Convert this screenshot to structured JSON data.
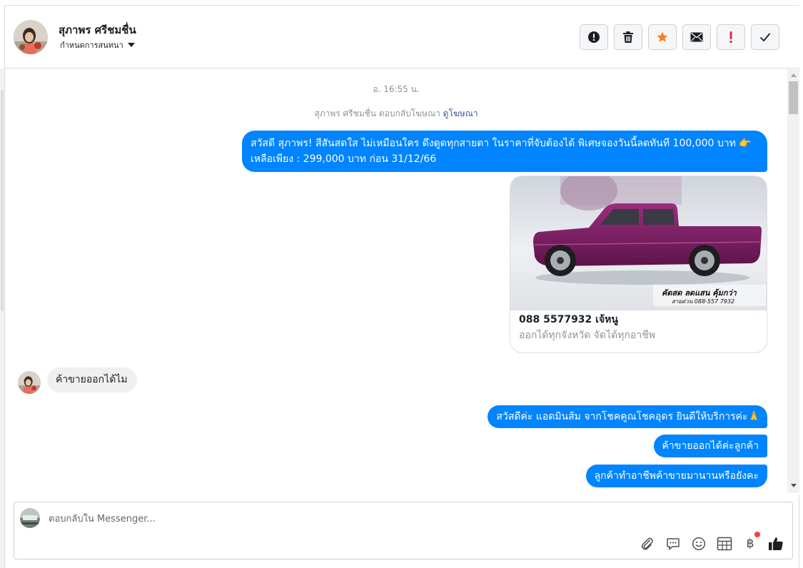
{
  "header": {
    "contact_name": "สุภาพร ศรีชมชื่น",
    "subtitle": "กำหนดการสนทนา",
    "actions": [
      {
        "icon": "alert-circle-icon",
        "name": "mark-spam-button"
      },
      {
        "icon": "trash-icon",
        "name": "delete-button"
      },
      {
        "icon": "star-icon",
        "name": "star-button",
        "color": "#f5821f"
      },
      {
        "icon": "envelope-icon",
        "name": "mark-unread-button"
      },
      {
        "icon": "exclamation-icon",
        "name": "mark-important-button",
        "color": "#e41e3f"
      },
      {
        "icon": "check-icon",
        "name": "mark-done-button"
      }
    ]
  },
  "thread": {
    "timestamp": "อ. 16:55 น.",
    "ad_note": "สุภาพร ศรีชมชื่น ตอบกลับโฆษณา",
    "ad_link": "ดูโฆษณา",
    "ad_message": "สวัสดี สุภาพร! สีสันสดใส ไม่เหมือนใคร ดึงดูดทุกสายตา ในราคาที่จับต้องได้ พิเศษจองวันนี้ลดทันที 100,000 บาท 👉 เหลือเพียง : 299,000 บาท ก่อน 31/12/66",
    "card": {
      "image_overlay_line1": "คัดสด ลดแสน คุ้มกว่า",
      "image_overlay_line2": "สายด่วน 088-557 7932",
      "title": "088 5577932 เจ้หนู",
      "subtitle": "ออกได้ทุกจังหวัด จัดได้ทุกอาชีพ"
    },
    "incoming": "ค้าขายออกได้ไม",
    "replies": [
      "สวัสดีค่ะ แอดมินส้ม จากโชคคูณโชคอุดร ยินดีให้บริการค่ะ🙏",
      "ค้าขายออกได้ค่ะลูกค้า",
      "ลูกค้าทำอาชีพค้าขายมานานหรือยังคะ"
    ]
  },
  "composer": {
    "placeholder": "ตอบกลับใน Messenger...",
    "tools": [
      "paperclip-icon",
      "quick-reply-icon",
      "emoji-icon",
      "table-icon",
      "baht-icon",
      "thumbs-up-icon"
    ],
    "baht_symbol": "฿"
  },
  "colors": {
    "brand_blue": "#0084ff",
    "star": "#f5821f",
    "important": "#e41e3f",
    "car": "#7a1f62"
  }
}
